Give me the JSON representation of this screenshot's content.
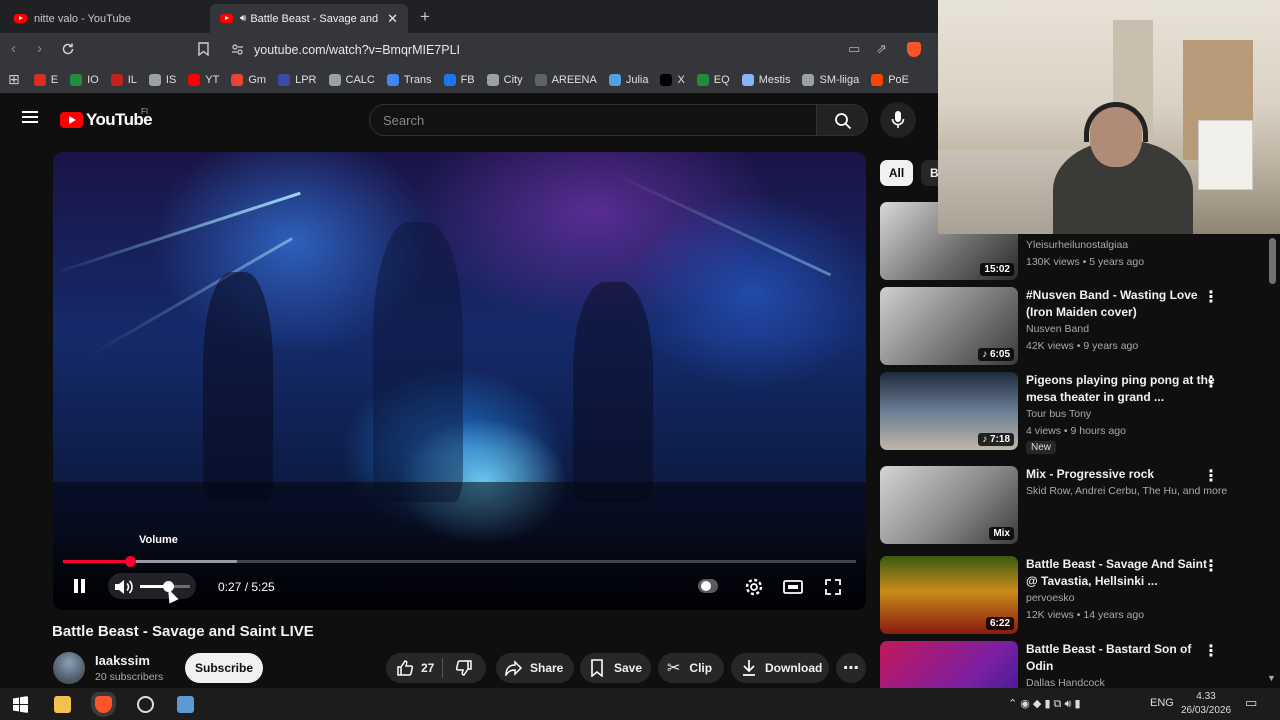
{
  "browser": {
    "tabs": [
      {
        "title": "nitte valo - YouTube",
        "active": false
      },
      {
        "title": "Battle Beast - Savage and Saint",
        "active": true
      }
    ],
    "url": "youtube.com/watch?v=BmqrMIE7PLI",
    "bookmarks": [
      {
        "label": "E",
        "color": "#d93025"
      },
      {
        "label": "IO",
        "color": "#1e8e3e"
      },
      {
        "label": "IL",
        "color": "#c5221f"
      },
      {
        "label": "IS",
        "color": "#9aa0a6"
      },
      {
        "label": "YT",
        "color": "#ff0000"
      },
      {
        "label": "Gm",
        "color": "#ea4335"
      },
      {
        "label": "LPR",
        "color": "#3c4aa8"
      },
      {
        "label": "CALC",
        "color": "#9aa0a6"
      },
      {
        "label": "Trans",
        "color": "#4285f4"
      },
      {
        "label": "FB",
        "color": "#1877f2"
      },
      {
        "label": "City",
        "color": "#9aa0a6"
      },
      {
        "label": "AREENA",
        "color": "#5f6368"
      },
      {
        "label": "Julia",
        "color": "#4fa3e0"
      },
      {
        "label": "X",
        "color": "#000000"
      },
      {
        "label": "EQ",
        "color": "#1e8e3e"
      },
      {
        "label": "Mestis",
        "color": "#8ab4f8"
      },
      {
        "label": "SM-liiga",
        "color": "#9aa0a6"
      },
      {
        "label": "PoE",
        "color": "#ff4500"
      }
    ]
  },
  "youtube": {
    "logo_text": "YouTube",
    "region": "FI",
    "search_placeholder": "Search"
  },
  "player": {
    "volume_tooltip": "Volume",
    "time_current": "0:27",
    "time_total": "5:25",
    "time_display": "0:27 / 5:25",
    "progress_fraction": 0.085,
    "buffer_fraction": 0.22,
    "volume_fraction": 0.55
  },
  "video": {
    "title": "Battle Beast - Savage and Saint LIVE",
    "channel": "Iaakssim",
    "subscribers": "20 subscribers",
    "subscribe_label": "Subscribe",
    "likes": "27",
    "share_label": "Share",
    "save_label": "Save",
    "clip_label": "Clip",
    "download_label": "Download"
  },
  "sidebar": {
    "chips": [
      "All",
      "B"
    ],
    "recommendations": [
      {
        "title": "",
        "channel": "Yleisurheilunostalgiaa",
        "meta": "130K views • 5 years ago",
        "duration": "15:02",
        "shorts": false
      },
      {
        "title": "#Nusven Band - Wasting Love (Iron Maiden cover)",
        "channel": "Nusven Band",
        "meta": "42K views • 9 years ago",
        "duration": "6:05",
        "shorts": true
      },
      {
        "title": "Pigeons playing ping pong at the mesa theater in grand ...",
        "channel": "Tour bus Tony",
        "meta": "4 views • 9 hours ago",
        "duration": "7:18",
        "shorts": true,
        "badge": "New"
      },
      {
        "title": "Mix - Progressive rock",
        "channel": "Skid Row, Andrei Cerbu, The Hu, and more",
        "meta": "",
        "duration": "Mix",
        "shorts": false
      },
      {
        "title": "Battle Beast - Savage And Saint @ Tavastia, Hellsinki ...",
        "channel": "pervoesko",
        "meta": "12K views • 14 years ago",
        "duration": "6:22",
        "shorts": false
      },
      {
        "title": "Battle Beast - Bastard Son of Odin",
        "channel": "Dallas Handcock",
        "meta": "",
        "duration": "",
        "shorts": false
      }
    ]
  },
  "taskbar": {
    "language": "ENG",
    "time": "4.33",
    "date": "26/03/2026"
  }
}
